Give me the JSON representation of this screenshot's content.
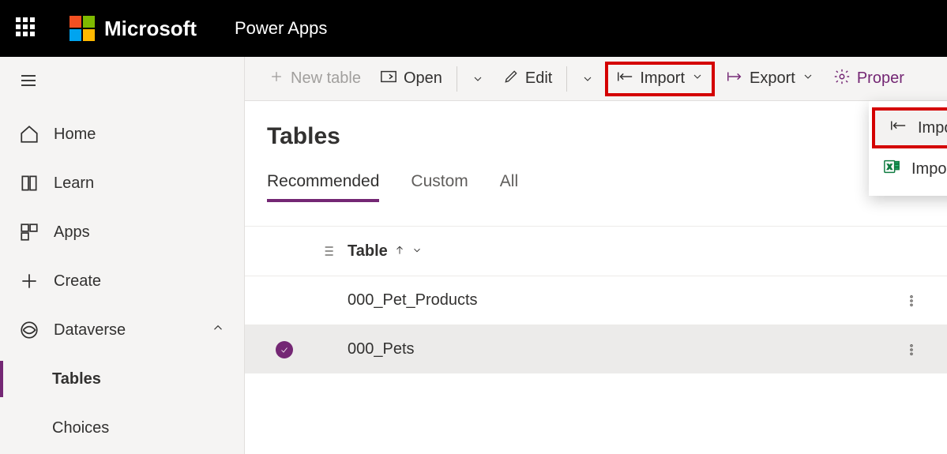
{
  "header": {
    "brand": "Microsoft",
    "app": "Power Apps"
  },
  "sidebar": {
    "home": "Home",
    "learn": "Learn",
    "apps": "Apps",
    "create": "Create",
    "dataverse": "Dataverse",
    "tables": "Tables",
    "choices": "Choices"
  },
  "toolbar": {
    "new_table": "New table",
    "open": "Open",
    "edit": "Edit",
    "import": "Import",
    "export": "Export",
    "properties": "Proper"
  },
  "import_menu": {
    "import_data": "Import data",
    "import_excel": "Import data from Excel"
  },
  "page": {
    "title": "Tables",
    "tabs": {
      "recommended": "Recommended",
      "custom": "Custom",
      "all": "All"
    }
  },
  "table": {
    "header_label": "Table",
    "rows": [
      {
        "name": "000_Pet_Products",
        "selected": false
      },
      {
        "name": "000_Pets",
        "selected": true
      }
    ]
  }
}
